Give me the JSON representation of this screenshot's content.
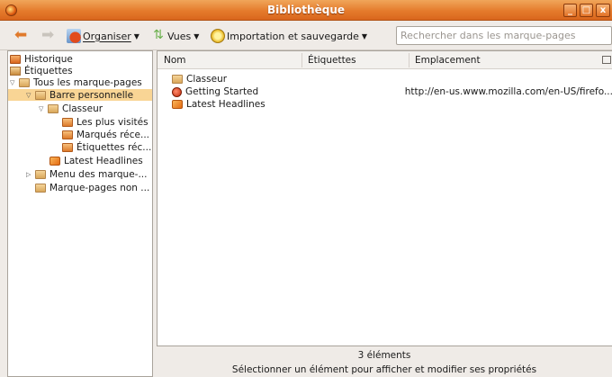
{
  "window": {
    "title": "Bibliothèque",
    "buttons": {
      "minimize": "_",
      "maximize": "□",
      "close": "x"
    }
  },
  "toolbar": {
    "back_icon": "back-arrow-icon",
    "forward_icon": "forward-arrow-icon",
    "organize_label": "Organiser",
    "views_label": "Vues",
    "import_label": "Importation et sauvegarde",
    "search_placeholder": "Rechercher dans les marque-pages"
  },
  "tree": {
    "items": [
      {
        "label": "Historique",
        "icon": "history-icon",
        "depth": 0,
        "expanded": null,
        "selected": false
      },
      {
        "label": "Étiquettes",
        "icon": "tags-icon",
        "depth": 0,
        "expanded": null,
        "selected": false
      },
      {
        "label": "Tous les marque-pages",
        "icon": "folder-icon",
        "depth": 0,
        "expanded": true,
        "selected": false
      },
      {
        "label": "Barre personnelle",
        "icon": "folder-icon",
        "depth": 1,
        "expanded": true,
        "selected": true
      },
      {
        "label": "Classeur",
        "icon": "folder-icon",
        "depth": 2,
        "expanded": true,
        "selected": false
      },
      {
        "label": "Les plus visités",
        "icon": "smart-folder-icon",
        "depth": 3,
        "expanded": null,
        "selected": false
      },
      {
        "label": "Marqués réce...",
        "icon": "smart-folder-icon",
        "depth": 3,
        "expanded": null,
        "selected": false
      },
      {
        "label": "Étiquettes réc...",
        "icon": "smart-folder-icon",
        "depth": 3,
        "expanded": null,
        "selected": false
      },
      {
        "label": "Latest Headlines",
        "icon": "rss-icon",
        "depth": 2,
        "expanded": null,
        "selected": false
      },
      {
        "label": "Menu des marque-...",
        "icon": "folder-icon",
        "depth": 1,
        "expanded": false,
        "selected": false
      },
      {
        "label": "Marque-pages non ...",
        "icon": "folder-icon",
        "depth": 1,
        "expanded": null,
        "selected": false
      }
    ]
  },
  "list": {
    "columns": [
      "Nom",
      "Étiquettes",
      "Emplacement"
    ],
    "rows": [
      {
        "name": "Classeur",
        "icon": "folder-icon",
        "tags": "",
        "location": ""
      },
      {
        "name": "Getting Started",
        "icon": "firefox-bookmark-icon",
        "tags": "",
        "location": "http://en-us.www.mozilla.com/en-US/firefo..."
      },
      {
        "name": "Latest Headlines",
        "icon": "rss-icon",
        "tags": "",
        "location": ""
      }
    ]
  },
  "details": {
    "count": "3 éléments",
    "hint": "Sélectionner un élément pour afficher et modifier ses propriétés"
  }
}
